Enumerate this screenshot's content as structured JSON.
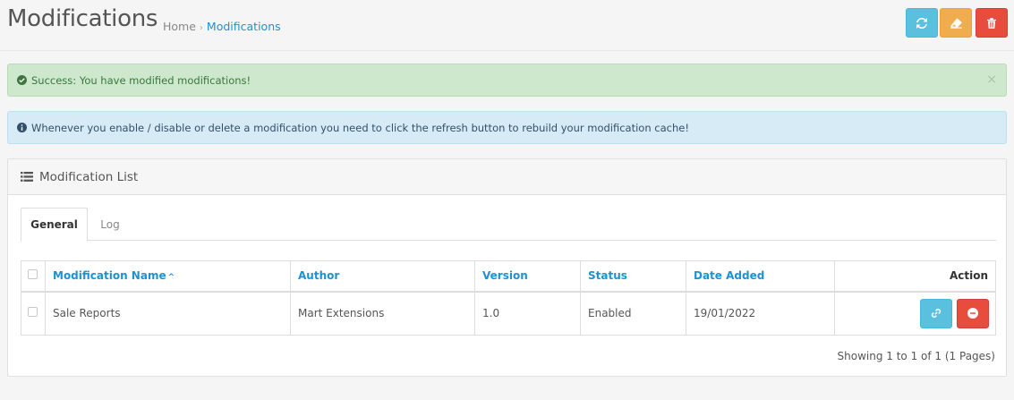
{
  "header": {
    "title": "Modifications",
    "breadcrumb": [
      {
        "label": "Home"
      },
      {
        "label": "Modifications"
      }
    ],
    "buttons": {
      "refresh_icon": "refresh-icon",
      "clear_icon": "eraser-icon",
      "delete_icon": "trash-icon"
    }
  },
  "alerts": {
    "success": "Success: You have modified modifications!",
    "success_close": "×",
    "info": "Whenever you enable / disable or delete a modification you need to click the refresh button to rebuild your modification cache!"
  },
  "panel": {
    "title": "Modification List",
    "tabs": [
      {
        "label": "General",
        "active": true
      },
      {
        "label": "Log",
        "active": false
      }
    ],
    "table": {
      "columns": [
        "Modification Name",
        "Author",
        "Version",
        "Status",
        "Date Added",
        "Action"
      ],
      "sort_indicator": "^",
      "rows": [
        {
          "name": "Sale Reports",
          "author": "Mart Extensions",
          "version": "1.0",
          "status": "Enabled",
          "date_added": "19/01/2022"
        }
      ]
    },
    "pagination_text": "Showing 1 to 1 of 1 (1 Pages)"
  },
  "colors": {
    "info": "#5bc0de",
    "warning": "#f0ad4e",
    "danger": "#e74c3c",
    "link": "#1e91cf"
  }
}
